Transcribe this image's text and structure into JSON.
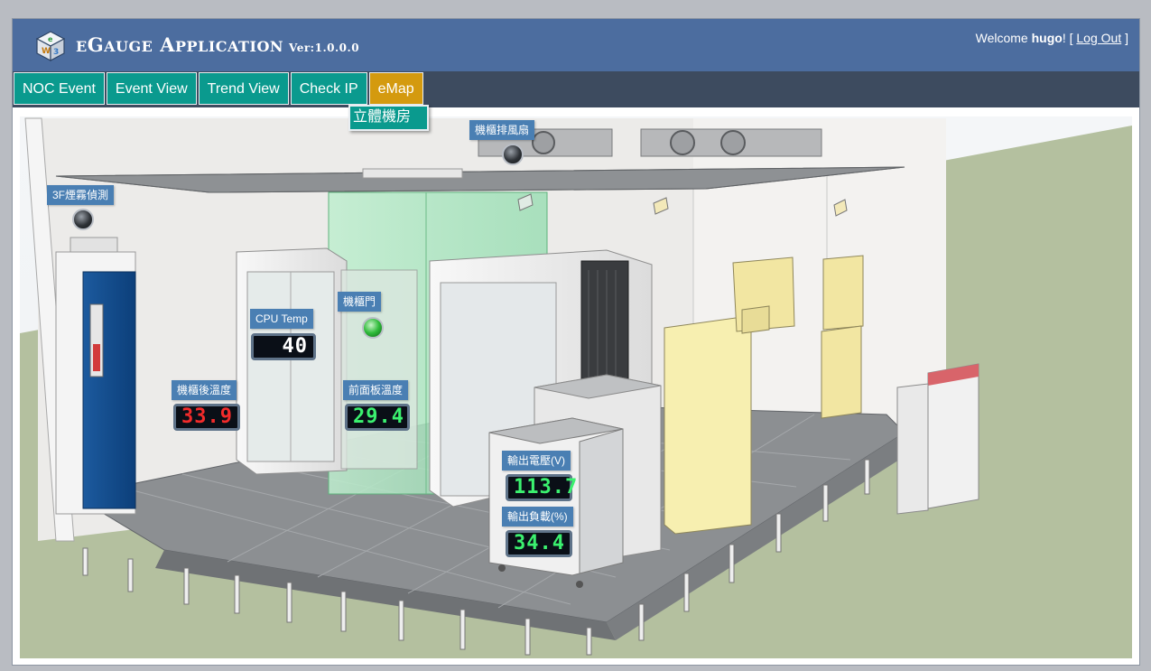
{
  "header": {
    "title_e": "E",
    "title_gauge_first": "G",
    "title_gauge_rest": "AUGE",
    "title_app_first": "A",
    "title_app_rest": "PPLICATION",
    "version": "Ver:1.0.0.0",
    "welcome_prefix": "Welcome ",
    "username": "hugo",
    "welcome_suffix": "! [ ",
    "logout_label": "Log Out",
    "welcome_end": " ]",
    "logo_icon": "cube-logo-icon"
  },
  "nav": {
    "tabs": [
      {
        "label": "NOC Event",
        "active": false
      },
      {
        "label": "Event View",
        "active": false
      },
      {
        "label": "Trend View",
        "active": false
      },
      {
        "label": "Check IP",
        "active": false
      },
      {
        "label": "eMap",
        "active": true
      }
    ],
    "submenu": [
      {
        "label": "立體機房"
      }
    ]
  },
  "map": {
    "sensors": {
      "exhaust_fan": {
        "label": "機櫃排風扇",
        "state": "off"
      },
      "smoke_detector": {
        "label": "3F煙霧偵測",
        "state": "off"
      },
      "cabinet_door": {
        "label": "機櫃門",
        "state": "on"
      },
      "cpu_temp": {
        "label": "CPU Temp",
        "value": "40"
      },
      "rear_temp": {
        "label": "機櫃後溫度",
        "value": "33.9"
      },
      "front_temp": {
        "label": "前面板溫度",
        "value": "29.4"
      },
      "output_voltage": {
        "label": "輸出電壓(V)",
        "value": "113.7"
      },
      "output_load": {
        "label": "輸出負載(%)",
        "value": "34.4"
      }
    }
  },
  "colors": {
    "header": "#4c6d9f",
    "navbar": "#3d4b5f",
    "tab": "#0a9a8e",
    "tab_active": "#d49a0f",
    "label": "#4a7fb3",
    "led_red": "#f32b2b",
    "led_green": "#3bf16f"
  }
}
